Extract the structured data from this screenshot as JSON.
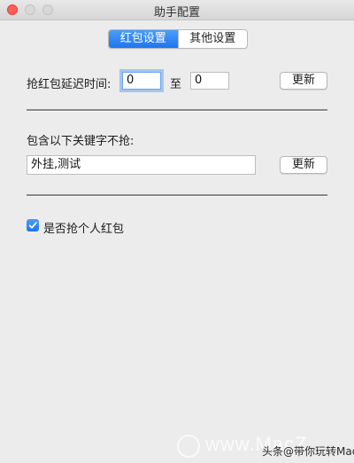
{
  "window": {
    "title": "助手配置"
  },
  "tabs": [
    {
      "label": "红包设置",
      "active": true
    },
    {
      "label": "其他设置",
      "active": false
    }
  ],
  "delay": {
    "label": "抢红包延迟时间:",
    "from_value": "0",
    "to_label": "至",
    "to_value": "0",
    "update_label": "更新"
  },
  "keywords": {
    "label": "包含以下关键字不抢:",
    "value": "外挂,测试",
    "update_label": "更新"
  },
  "personal": {
    "label": "是否抢个人红包",
    "checked": true
  },
  "watermark": {
    "site": "www.MacZ",
    "caption": "头条@带你玩转Mac"
  },
  "colors": {
    "accent": "#1d76ef",
    "close": "#fc5f57",
    "background": "#ececec"
  },
  "icons": {
    "checkmark": "checkmark-icon",
    "logo": "macz-logo-icon"
  }
}
